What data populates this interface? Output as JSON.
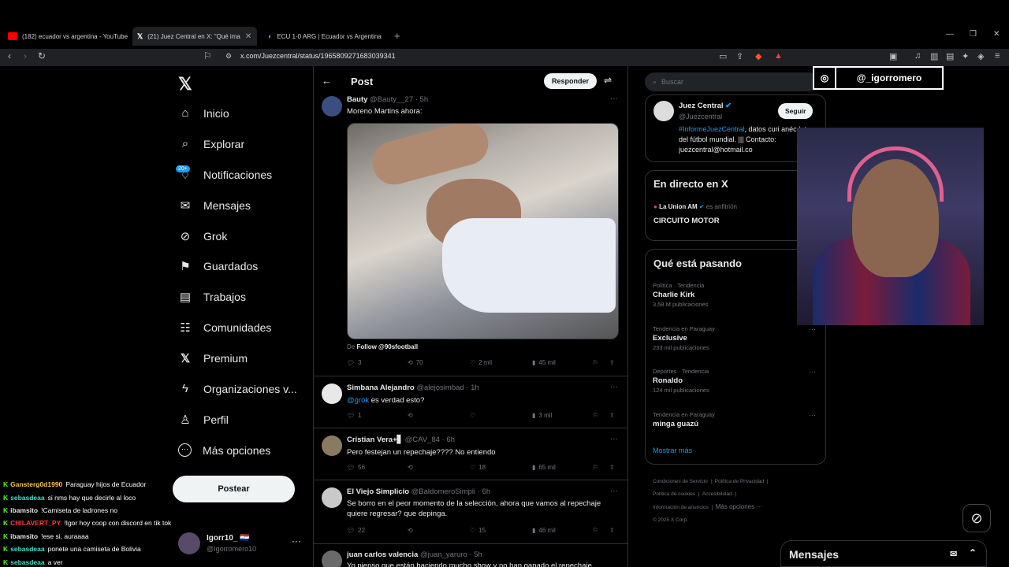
{
  "browser": {
    "tabs": [
      {
        "title": "(182) ecuador vs argentina - YouTube",
        "icon": "youtube-icon",
        "color": "#ff0000"
      },
      {
        "title": "(21) Juez Central en X: \"Qué ima",
        "icon": "x-icon",
        "color": "#ffffff"
      },
      {
        "title": "ECU 1-0 ARG | Ecuador vs Argentina",
        "icon": "globe-icon",
        "color": "#4aa3ff"
      }
    ],
    "new_tab": "+",
    "url": "x.com/Juezcentral/status/1965809271683039341"
  },
  "nav": {
    "items": [
      {
        "label": "Inicio",
        "icon": "⌂"
      },
      {
        "label": "Explorar",
        "icon": "⌕"
      },
      {
        "label": "Notificaciones",
        "icon": "♫"
      },
      {
        "label": "Mensajes",
        "icon": "✉"
      },
      {
        "label": "Grok",
        "icon": "⊘"
      },
      {
        "label": "Guardados",
        "icon": "⚑"
      },
      {
        "label": "Trabajos",
        "icon": "▤"
      },
      {
        "label": "Comunidades",
        "icon": "☷"
      },
      {
        "label": "Premium",
        "icon": "X"
      },
      {
        "label": "Organizaciones v...",
        "icon": "ϟ"
      },
      {
        "label": "Perfil",
        "icon": "♙"
      },
      {
        "label": "Más opciones",
        "icon": "⋯"
      }
    ],
    "notif_badge": "20+",
    "post_button": "Postear",
    "profile_name": "Igorr10_ 🇵🇾",
    "profile_handle": "@Igorromero10"
  },
  "post": {
    "header": "Post",
    "reply_button": "Responder",
    "main": {
      "name": "Bauty",
      "handle": "@Bauty__27 · 5h",
      "text": "Moreno Martins ahora:",
      "source_prefix": "De",
      "source_link": "Follow @90sfootball",
      "replies": "3",
      "reposts": "70",
      "likes": "2 mil",
      "views": "45 mil"
    },
    "replies": [
      {
        "name": "Simbana Alejandro",
        "handle": "@alejosimbad · 1h",
        "mention": "@grok",
        "text": " es verdad esto?",
        "replies": "1",
        "reposts": "",
        "likes": "",
        "views": "3 mil"
      },
      {
        "name": "Cristian Vera+▋",
        "handle": "@CAV_84 · 6h",
        "mention": "",
        "text": "Pero festejan un repechaje???? No entiendo",
        "replies": "56",
        "reposts": "",
        "likes": "18",
        "views": "65 mil"
      },
      {
        "name": "El Viejo Simplicio",
        "handle": "@BaldomeroSimpli · 6h",
        "mention": "",
        "text": "Se borro en el peor momento de la selección, ahora que vamos al repechaje quiere regresar? que depinga.",
        "replies": "22",
        "reposts": "",
        "likes": "15",
        "views": "46 mil"
      },
      {
        "name": "juan carlos valencia",
        "handle": "@juan_yaruro · 5h",
        "mention": "",
        "text": "Yo pienso que están haciendo mucho show y no han ganado el repechaje",
        "replies": "",
        "reposts": "",
        "likes": "",
        "views": ""
      }
    ]
  },
  "sidebar": {
    "search_placeholder": "Buscar",
    "profile_card": {
      "name": "Juez Central",
      "handle": "@Juezcentral",
      "follow": "Seguir",
      "bio_tag": "#InformeJuezCentral",
      "bio": ", datos curi anécdotas del fútbol mundial. ||| Contacto: juezcentral@hotmail.co"
    },
    "live": {
      "title": "En directo en X",
      "host": "La Union AM",
      "host_suffix": "es anfitrión",
      "show": "CIRCUITO MOTOR"
    },
    "trending": {
      "title": "Qué está pasando",
      "items": [
        {
          "context": "Política · Tendencia",
          "topic": "Charlie Kirk",
          "count": "3,58 M publicaciones"
        },
        {
          "context": "Tendencia en Paraguay",
          "topic": "Exclusive",
          "count": "233 mil publicaciones"
        },
        {
          "context": "Deportes · Tendencia",
          "topic": "Ronaldo",
          "count": "124 mil publicaciones"
        },
        {
          "context": "Tendencia en Paraguay",
          "topic": "minga guazú",
          "count": ""
        }
      ],
      "show_more": "Mostrar más"
    },
    "footer": {
      "l1a": "Condiciones de Servicio",
      "l1b": "Política de Privacidad",
      "l2a": "Política de cookies",
      "l2b": "Accesibilidad",
      "l3a": "Información de anuncios",
      "l3b": "Más opciones ···",
      "copy": "© 2025 X Corp."
    }
  },
  "overlay": {
    "instagram": "@_igorromero",
    "messages": "Mensajes"
  },
  "chat": [
    {
      "user": "Gansterg0d1990",
      "color": "#f5c542",
      "msg": "Paraguay hijos de Ecuador"
    },
    {
      "user": "sebasdeaa",
      "color": "#3fe0c5",
      "msg": "si nms hay que decirle al loco"
    },
    {
      "user": "ibamsito",
      "color": "#e7e7e7",
      "msg": "!Camiseta de ladrones no"
    },
    {
      "user": "CHILAVERT_PY",
      "color": "#ff3b3b",
      "msg": "!Igor hoy coop con discord en tik tok"
    },
    {
      "user": "ibamsito",
      "color": "#e7e7e7",
      "msg": "!ese si, auraaaa"
    },
    {
      "user": "sebasdeaa",
      "color": "#3fe0c5",
      "msg": "ponete una camiseta de Bolivia"
    },
    {
      "user": "sebasdeaa",
      "color": "#3fe0c5",
      "msg": "a ver"
    }
  ]
}
